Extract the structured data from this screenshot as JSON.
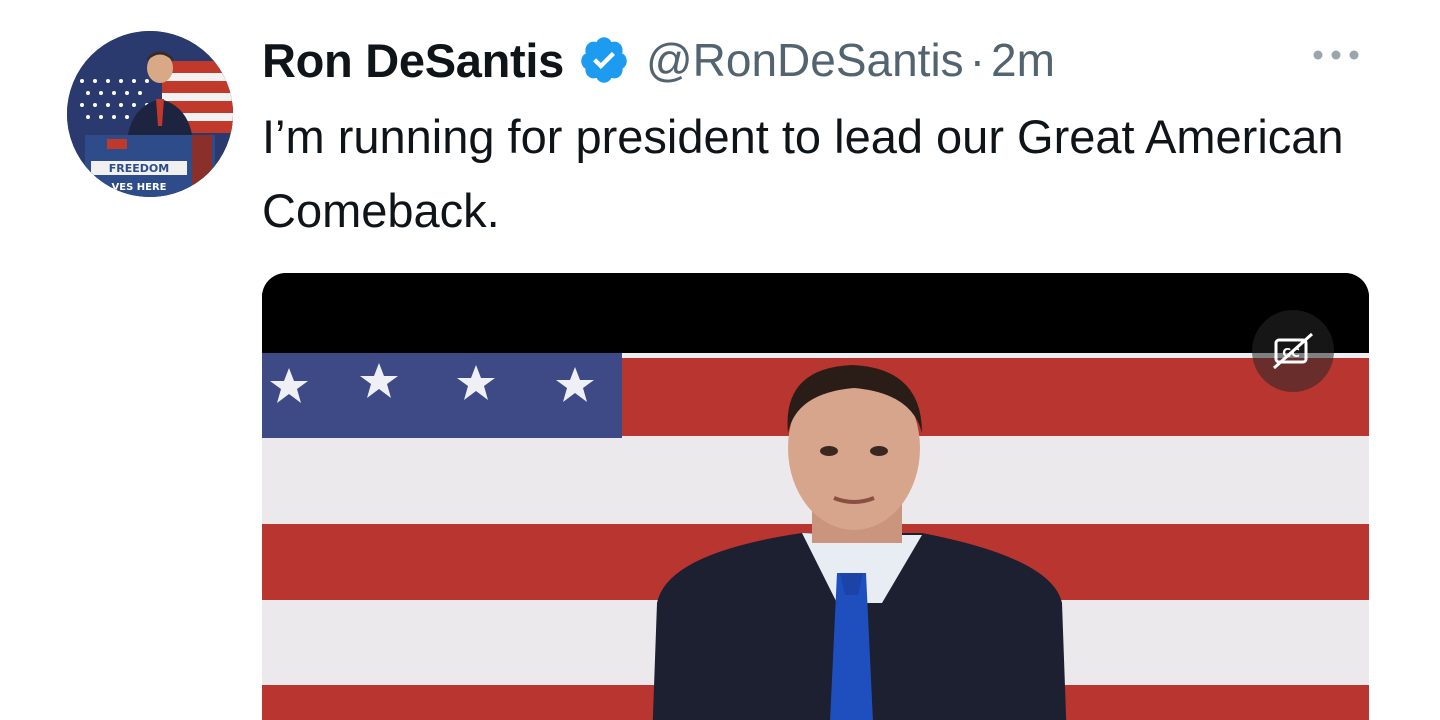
{
  "author": {
    "display_name": "Ron DeSantis",
    "handle": "@RonDeSantis",
    "separator": "·",
    "timestamp": "2m",
    "verified": true,
    "avatar_sign_line1": "FREEDOM",
    "avatar_sign_line2": "VES HERE"
  },
  "tweet": {
    "text": "I’m running for president to lead our Great American Comeback."
  },
  "media": {
    "type": "video",
    "captions_icon": "closed-captions-off-icon"
  },
  "colors": {
    "verified": "#1d9bf0",
    "text": "#0f1419",
    "secondary": "#536471",
    "flag_red": "#b9352f",
    "flag_blue": "#3d4a86"
  }
}
